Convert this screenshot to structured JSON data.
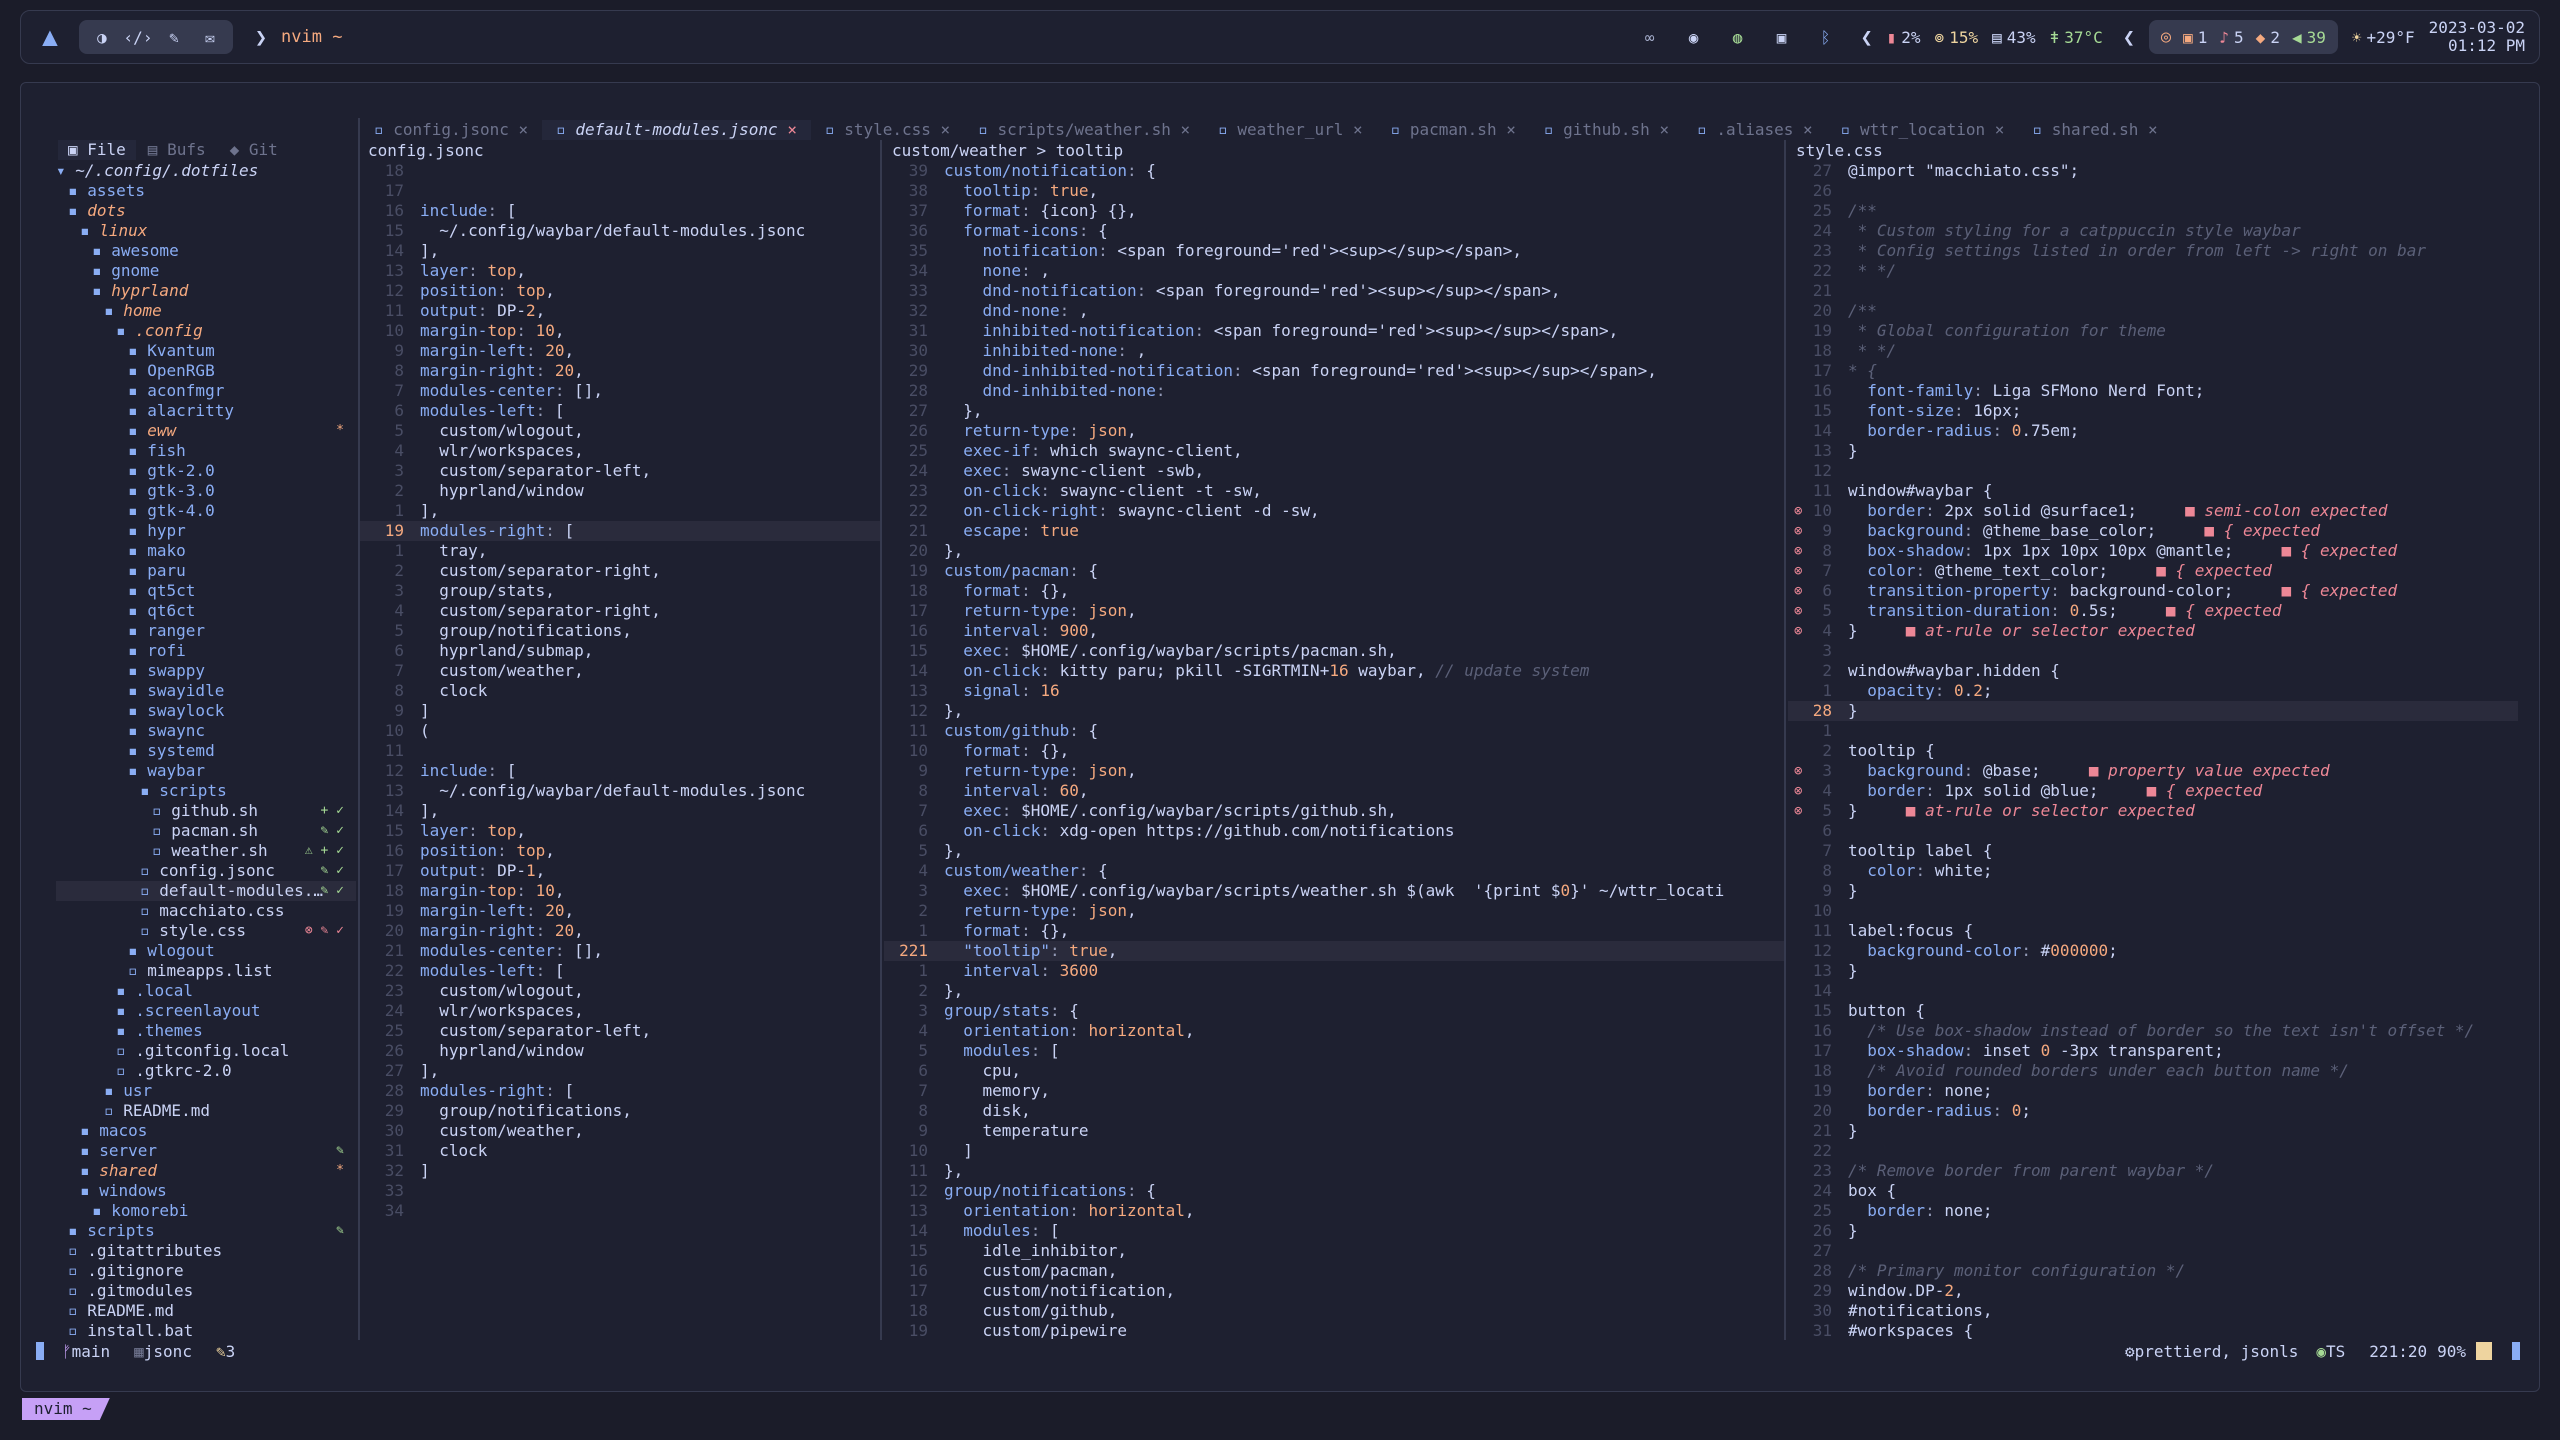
{
  "topbar": {
    "workspace_title": "nvim ~",
    "stats": {
      "battery": "2%",
      "cpu": "15%",
      "disk": "43%",
      "temp": "37°C"
    },
    "notif": {
      "a": "1",
      "b": "5",
      "c": "2",
      "vol": "39"
    },
    "weather": "+29°F",
    "date": "2023-03-02",
    "time": "01:12 PM"
  },
  "sidebar": {
    "tabs": [
      "File",
      "Bufs",
      "Git"
    ],
    "root": "~/.config/.dotfiles",
    "items": [
      {
        "d": 1,
        "t": "assets",
        "k": "folder"
      },
      {
        "d": 1,
        "t": "dots",
        "k": "folder-mod"
      },
      {
        "d": 2,
        "t": "linux",
        "k": "folder-mod"
      },
      {
        "d": 3,
        "t": "awesome",
        "k": "folder"
      },
      {
        "d": 3,
        "t": "gnome",
        "k": "folder"
      },
      {
        "d": 3,
        "t": "hyprland",
        "k": "folder-mod"
      },
      {
        "d": 4,
        "t": "home",
        "k": "folder-mod"
      },
      {
        "d": 5,
        "t": ".config",
        "k": "folder-mod"
      },
      {
        "d": 6,
        "t": "Kvantum",
        "k": "folder"
      },
      {
        "d": 6,
        "t": "OpenRGB",
        "k": "folder"
      },
      {
        "d": 6,
        "t": "aconfmgr",
        "k": "folder"
      },
      {
        "d": 6,
        "t": "alacritty",
        "k": "folder"
      },
      {
        "d": 6,
        "t": "eww",
        "k": "folder-mod",
        "badge": "*"
      },
      {
        "d": 6,
        "t": "fish",
        "k": "folder"
      },
      {
        "d": 6,
        "t": "gtk-2.0",
        "k": "folder"
      },
      {
        "d": 6,
        "t": "gtk-3.0",
        "k": "folder"
      },
      {
        "d": 6,
        "t": "gtk-4.0",
        "k": "folder"
      },
      {
        "d": 6,
        "t": "hypr",
        "k": "folder"
      },
      {
        "d": 6,
        "t": "mako",
        "k": "folder"
      },
      {
        "d": 6,
        "t": "paru",
        "k": "folder"
      },
      {
        "d": 6,
        "t": "qt5ct",
        "k": "folder"
      },
      {
        "d": 6,
        "t": "qt6ct",
        "k": "folder"
      },
      {
        "d": 6,
        "t": "ranger",
        "k": "folder"
      },
      {
        "d": 6,
        "t": "rofi",
        "k": "folder"
      },
      {
        "d": 6,
        "t": "swappy",
        "k": "folder"
      },
      {
        "d": 6,
        "t": "swayidle",
        "k": "folder"
      },
      {
        "d": 6,
        "t": "swaylock",
        "k": "folder"
      },
      {
        "d": 6,
        "t": "swaync",
        "k": "folder"
      },
      {
        "d": 6,
        "t": "systemd",
        "k": "folder"
      },
      {
        "d": 6,
        "t": "waybar",
        "k": "folder"
      },
      {
        "d": 7,
        "t": "scripts",
        "k": "folder"
      },
      {
        "d": 8,
        "t": "github.sh",
        "k": "file",
        "badge": "+ ✓"
      },
      {
        "d": 8,
        "t": "pacman.sh",
        "k": "file",
        "badge": "✎ ✓"
      },
      {
        "d": 8,
        "t": "weather.sh",
        "k": "file",
        "badge": "⚠ + ✓"
      },
      {
        "d": 7,
        "t": "config.jsonc",
        "k": "file",
        "badge": "✎ ✓"
      },
      {
        "d": 7,
        "t": "default-modules.…",
        "k": "file",
        "badge": "✎ ✓"
      },
      {
        "d": 7,
        "t": "macchiato.css",
        "k": "file"
      },
      {
        "d": 7,
        "t": "style.css",
        "k": "file",
        "badge": "⊗ ✎ ✓"
      },
      {
        "d": 6,
        "t": "wlogout",
        "k": "folder"
      },
      {
        "d": 6,
        "t": "mimeapps.list",
        "k": "file"
      },
      {
        "d": 5,
        "t": ".local",
        "k": "folder"
      },
      {
        "d": 5,
        "t": ".screenlayout",
        "k": "folder"
      },
      {
        "d": 5,
        "t": ".themes",
        "k": "folder"
      },
      {
        "d": 5,
        "t": ".gitconfig.local",
        "k": "file"
      },
      {
        "d": 5,
        "t": ".gtkrc-2.0",
        "k": "file"
      },
      {
        "d": 4,
        "t": "usr",
        "k": "folder"
      },
      {
        "d": 4,
        "t": "README.md",
        "k": "file"
      },
      {
        "d": 2,
        "t": "macos",
        "k": "folder"
      },
      {
        "d": 2,
        "t": "server",
        "k": "folder",
        "badge": "✎"
      },
      {
        "d": 2,
        "t": "shared",
        "k": "folder-mod",
        "badge": "*"
      },
      {
        "d": 2,
        "t": "windows",
        "k": "folder"
      },
      {
        "d": 3,
        "t": "komorebi",
        "k": "folder"
      },
      {
        "d": 1,
        "t": "scripts",
        "k": "folder",
        "badge": "✎"
      },
      {
        "d": 1,
        "t": ".gitattributes",
        "k": "file"
      },
      {
        "d": 1,
        "t": ".gitignore",
        "k": "file"
      },
      {
        "d": 1,
        "t": ".gitmodules",
        "k": "file"
      },
      {
        "d": 1,
        "t": "README.md",
        "k": "file"
      },
      {
        "d": 1,
        "t": "install.bat",
        "k": "file"
      }
    ]
  },
  "tabs": [
    {
      "t": "config.jsonc",
      "a": false
    },
    {
      "t": "default-modules.jsonc",
      "a": true
    },
    {
      "t": "style.css",
      "a": false
    },
    {
      "t": "scripts/weather.sh",
      "a": false
    },
    {
      "t": "weather_url",
      "a": false
    },
    {
      "t": "pacman.sh",
      "a": false
    },
    {
      "t": "github.sh",
      "a": false
    },
    {
      "t": ".aliases",
      "a": false
    },
    {
      "t": "wttr_location",
      "a": false
    },
    {
      "t": "shared.sh",
      "a": false
    }
  ],
  "panes": {
    "left": {
      "header": "config.jsonc",
      "lines": [
        [
          "18",
          ""
        ],
        [
          "17",
          ""
        ],
        [
          "16",
          "include: ["
        ],
        [
          "15",
          "  ~/.config/waybar/default-modules.jsonc"
        ],
        [
          "14",
          "],"
        ],
        [
          "13",
          "layer: top,"
        ],
        [
          "12",
          "position: top,"
        ],
        [
          "11",
          "output: DP-2,"
        ],
        [
          "10",
          "margin-top: 10,"
        ],
        [
          "9",
          "margin-left: 20,"
        ],
        [
          "8",
          "margin-right: 20,"
        ],
        [
          "7",
          "modules-center: [],"
        ],
        [
          "6",
          "modules-left: ["
        ],
        [
          "5",
          "  custom/wlogout,"
        ],
        [
          "4",
          "  wlr/workspaces,"
        ],
        [
          "3",
          "  custom/separator-left,"
        ],
        [
          "2",
          "  hyprland/window"
        ],
        [
          "1",
          "],"
        ],
        [
          "19",
          "modules-right: ["
        ],
        [
          "1",
          "  tray,"
        ],
        [
          "2",
          "  custom/separator-right,"
        ],
        [
          "3",
          "  group/stats,"
        ],
        [
          "4",
          "  custom/separator-right,"
        ],
        [
          "5",
          "  group/notifications,"
        ],
        [
          "6",
          "  hyprland/submap,"
        ],
        [
          "7",
          "  custom/weather,"
        ],
        [
          "8",
          "  clock"
        ],
        [
          "9",
          "]"
        ],
        [
          "10",
          "("
        ],
        [
          "11",
          ""
        ],
        [
          "12",
          "include: ["
        ],
        [
          "13",
          "  ~/.config/waybar/default-modules.jsonc"
        ],
        [
          "14",
          "],"
        ],
        [
          "15",
          "layer: top,"
        ],
        [
          "16",
          "position: top,"
        ],
        [
          "17",
          "output: DP-1,"
        ],
        [
          "18",
          "margin-top: 10,"
        ],
        [
          "19",
          "margin-left: 20,"
        ],
        [
          "20",
          "margin-right: 20,"
        ],
        [
          "21",
          "modules-center: [],"
        ],
        [
          "22",
          "modules-left: ["
        ],
        [
          "23",
          "  custom/wlogout,"
        ],
        [
          "24",
          "  wlr/workspaces,"
        ],
        [
          "25",
          "  custom/separator-left,"
        ],
        [
          "26",
          "  hyprland/window"
        ],
        [
          "27",
          "],"
        ],
        [
          "28",
          "modules-right: ["
        ],
        [
          "29",
          "  group/notifications,"
        ],
        [
          "30",
          "  custom/weather,"
        ],
        [
          "31",
          "  clock"
        ],
        [
          "32",
          "]"
        ],
        [
          "33",
          ""
        ],
        [
          "34",
          ""
        ]
      ]
    },
    "middle": {
      "header": "custom/weather > tooltip",
      "lines": [
        [
          "39",
          "custom/notification: {"
        ],
        [
          "38",
          "  tooltip: true,"
        ],
        [
          "37",
          "  format: {icon} {},"
        ],
        [
          "36",
          "  format-icons: {"
        ],
        [
          "35",
          "    notification: <span foreground='red'><sup></sup></span>,"
        ],
        [
          "34",
          "    none: ,"
        ],
        [
          "33",
          "    dnd-notification: <span foreground='red'><sup></sup></span>,"
        ],
        [
          "32",
          "    dnd-none: ,"
        ],
        [
          "31",
          "    inhibited-notification: <span foreground='red'><sup></sup></span>,"
        ],
        [
          "30",
          "    inhibited-none: ,"
        ],
        [
          "29",
          "    dnd-inhibited-notification: <span foreground='red'><sup></sup></span>,"
        ],
        [
          "28",
          "    dnd-inhibited-none: "
        ],
        [
          "27",
          "  },"
        ],
        [
          "26",
          "  return-type: json,"
        ],
        [
          "25",
          "  exec-if: which swaync-client,"
        ],
        [
          "24",
          "  exec: swaync-client -swb,"
        ],
        [
          "23",
          "  on-click: swaync-client -t -sw,"
        ],
        [
          "22",
          "  on-click-right: swaync-client -d -sw,"
        ],
        [
          "21",
          "  escape: true"
        ],
        [
          "20",
          "},"
        ],
        [
          "19",
          "custom/pacman: {"
        ],
        [
          "18",
          "  format: {},"
        ],
        [
          "17",
          "  return-type: json,"
        ],
        [
          "16",
          "  interval: 900,"
        ],
        [
          "15",
          "  exec: $HOME/.config/waybar/scripts/pacman.sh,"
        ],
        [
          "14",
          "  on-click: kitty paru; pkill -SIGRTMIN+16 waybar, // update system"
        ],
        [
          "13",
          "  signal: 16"
        ],
        [
          "12",
          "},"
        ],
        [
          "11",
          "custom/github: {"
        ],
        [
          "10",
          "  format: {},"
        ],
        [
          "9",
          "  return-type: json,"
        ],
        [
          "8",
          "  interval: 60,"
        ],
        [
          "7",
          "  exec: $HOME/.config/waybar/scripts/github.sh,"
        ],
        [
          "6",
          "  on-click: xdg-open https://github.com/notifications"
        ],
        [
          "5",
          "},"
        ],
        [
          "4",
          "custom/weather: {"
        ],
        [
          "3",
          "  exec: $HOME/.config/waybar/scripts/weather.sh $(awk  '{print $0}' ~/wttr_locati"
        ],
        [
          "2",
          "  return-type: json,"
        ],
        [
          "1",
          "  format: {},"
        ],
        [
          "221",
          "  \"tooltip\": true,"
        ],
        [
          "1",
          "  interval: 3600"
        ],
        [
          "2",
          "},"
        ],
        [
          "3",
          "group/stats: {"
        ],
        [
          "4",
          "  orientation: horizontal,"
        ],
        [
          "5",
          "  modules: ["
        ],
        [
          "6",
          "    cpu,"
        ],
        [
          "7",
          "    memory,"
        ],
        [
          "8",
          "    disk,"
        ],
        [
          "9",
          "    temperature"
        ],
        [
          "10",
          "  ]"
        ],
        [
          "11",
          "},"
        ],
        [
          "12",
          "group/notifications: {"
        ],
        [
          "13",
          "  orientation: horizontal,"
        ],
        [
          "14",
          "  modules: ["
        ],
        [
          "15",
          "    idle_inhibitor,"
        ],
        [
          "16",
          "    custom/pacman,"
        ],
        [
          "17",
          "    custom/notification,"
        ],
        [
          "18",
          "    custom/github,"
        ],
        [
          "19",
          "    custom/pipewire"
        ]
      ]
    },
    "right": {
      "header": "style.css",
      "lines": [
        [
          "27",
          "@import \"macchiato.css\";"
        ],
        [
          "26",
          ""
        ],
        [
          "25",
          "/**"
        ],
        [
          "24",
          " * Custom styling for a catppuccin style waybar"
        ],
        [
          "23",
          " * Config settings listed in order from left -> right on bar"
        ],
        [
          "22",
          " * */"
        ],
        [
          "21",
          ""
        ],
        [
          "20",
          "/**"
        ],
        [
          "19",
          " * Global configuration for theme"
        ],
        [
          "18",
          " * */"
        ],
        [
          "17",
          "* {"
        ],
        [
          "16",
          "  font-family: Liga SFMono Nerd Font;"
        ],
        [
          "15",
          "  font-size: 16px;"
        ],
        [
          "14",
          "  border-radius: 0.75em;"
        ],
        [
          "13",
          "}"
        ],
        [
          "12",
          ""
        ],
        [
          "11",
          "window#waybar {"
        ],
        [
          "10",
          "  border: 2px solid @surface1;     ■ semi-colon expected"
        ],
        [
          "9",
          "  background: @theme_base_color;     ■ { expected"
        ],
        [
          "8",
          "  box-shadow: 1px 1px 10px 10px @mantle;     ■ { expected"
        ],
        [
          "7",
          "  color: @theme_text_color;     ■ { expected"
        ],
        [
          "6",
          "  transition-property: background-color;     ■ { expected"
        ],
        [
          "5",
          "  transition-duration: 0.5s;     ■ { expected"
        ],
        [
          "4",
          "}     ■ at-rule or selector expected"
        ],
        [
          "3",
          ""
        ],
        [
          "2",
          "window#waybar.hidden {"
        ],
        [
          "1",
          "  opacity: 0.2;"
        ],
        [
          "28",
          "}"
        ],
        [
          "1",
          ""
        ],
        [
          "2",
          "tooltip {"
        ],
        [
          "3",
          "  background: @base;     ■ property value expected"
        ],
        [
          "4",
          "  border: 1px solid @blue;     ■ { expected"
        ],
        [
          "5",
          "}     ■ at-rule or selector expected"
        ],
        [
          "6",
          ""
        ],
        [
          "7",
          "tooltip label {"
        ],
        [
          "8",
          "  color: white;"
        ],
        [
          "9",
          "}"
        ],
        [
          "10",
          ""
        ],
        [
          "11",
          "label:focus {"
        ],
        [
          "12",
          "  background-color: #000000;"
        ],
        [
          "13",
          "}"
        ],
        [
          "14",
          ""
        ],
        [
          "15",
          "button {"
        ],
        [
          "16",
          "  /* Use box-shadow instead of border so the text isn't offset */"
        ],
        [
          "17",
          "  box-shadow: inset 0 -3px transparent;"
        ],
        [
          "18",
          "  /* Avoid rounded borders under each button name */"
        ],
        [
          "19",
          "  border: none;"
        ],
        [
          "20",
          "  border-radius: 0;"
        ],
        [
          "21",
          "}"
        ],
        [
          "22",
          ""
        ],
        [
          "23",
          "/* Remove border from parent waybar */"
        ],
        [
          "24",
          "box {"
        ],
        [
          "25",
          "  border: none;"
        ],
        [
          "26",
          "}"
        ],
        [
          "27",
          ""
        ],
        [
          "28",
          "/* Primary monitor configuration */"
        ],
        [
          "29",
          "window.DP-2,"
        ],
        [
          "30",
          "#notifications,"
        ],
        [
          "31",
          "#workspaces {"
        ]
      ]
    }
  },
  "status": {
    "branch": "main",
    "filetype": "jsonc",
    "edits": "3",
    "lsp": "prettierd, jsonls",
    "ts": "TS",
    "pos": "221:20",
    "pct": "90%"
  },
  "bottom_tag": "nvim ~"
}
